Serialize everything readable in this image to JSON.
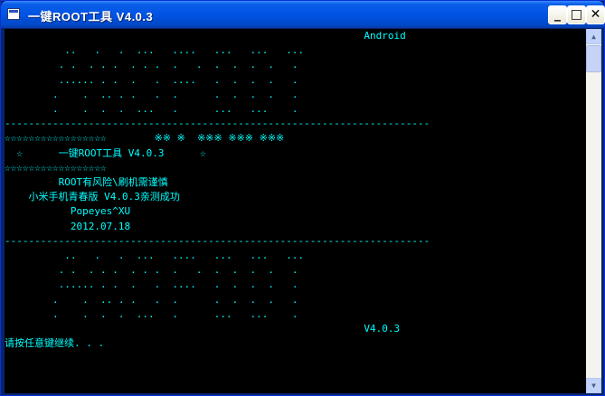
{
  "window": {
    "title": "一键ROOT工具 V4.0.3"
  },
  "caption_buttons": {
    "minimize": "_",
    "maximize": "□",
    "close": "✕"
  },
  "console": {
    "lines": [
      "                                                            Android",
      "          ..   .   .  ...   ....   ...   ...   ...",
      "         . .  . . .  . . .  .   .  .  .  .  .   .",
      "         ...... . .  .   .  ....   .  .  .  .   .",
      "        .    .  .. . .   .  .      .  .  .  .   .",
      "        .    .  .  .  ...   .      ...   ...    .",
      "-----------------------------------------------------------------------",
      "☆☆☆☆☆☆☆☆☆☆☆☆☆☆☆☆☆        ※※ ※  ※※※ ※※※ ※※※",
      "  ☆      一键ROOT工具 V4.0.3      ☆",
      "☆☆☆☆☆☆☆☆☆☆☆☆☆☆☆☆☆",
      "         ROOT有风险\\刷机需谨慎",
      "    小米手机青春版 V4.0.3亲测成功",
      "           Popeyes^XU",
      "           2012.07.18",
      "-----------------------------------------------------------------------",
      "          ..   .   .  ...   ....   ...   ...   ...",
      "         . .  . . .  . . .  .   .  .  .  .  .   .",
      "         ...... . .  .   .  ....   .  .  .  .   .",
      "        .    .  .. . .   .  .      .  .  .  .   .",
      "        .    .  .  .  ...   .      ...   ...    .",
      "                                                            V4.0.3",
      "请按任意键继续. . ."
    ]
  }
}
